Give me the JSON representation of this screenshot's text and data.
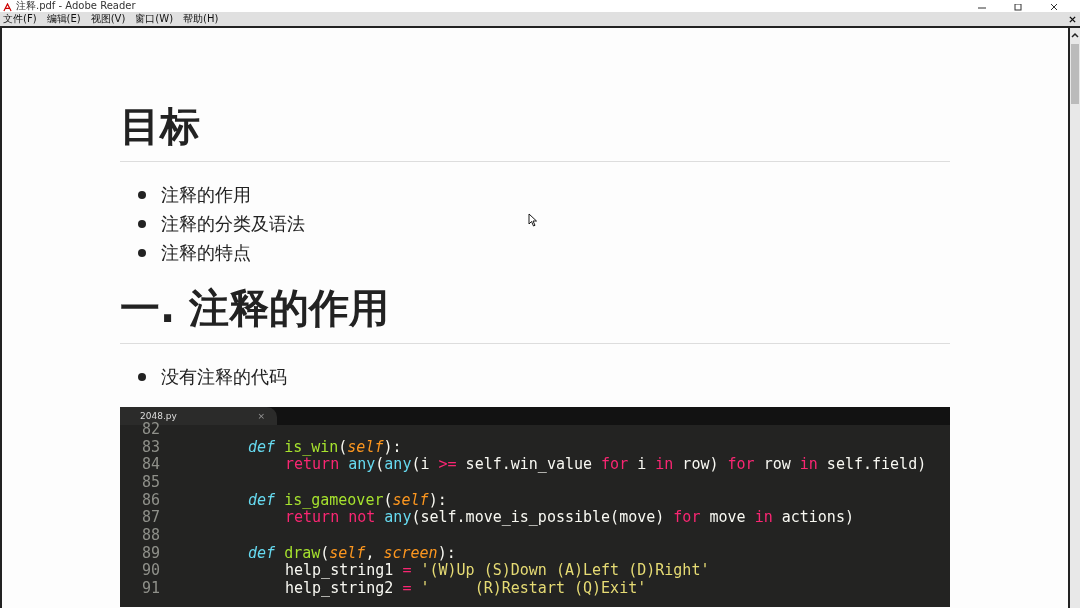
{
  "window": {
    "title": "注释.pdf - Adobe Reader"
  },
  "menu": [
    "文件(F)",
    "编辑(E)",
    "视图(V)",
    "窗口(W)",
    "帮助(H)"
  ],
  "document": [
    {
      "kind": "heading",
      "text": "目标"
    },
    {
      "kind": "bullets",
      "items": [
        "注释的作用",
        "注释的分类及语法",
        "注释的特点"
      ]
    },
    {
      "kind": "heading",
      "text": "一. 注释的作用"
    },
    {
      "kind": "bullets",
      "items": [
        "没有注释的代码"
      ]
    },
    {
      "kind": "code",
      "tab": "2048.py",
      "tab_close": "×",
      "lines": [
        {
          "number": "82"
        },
        {
          "number": "83",
          "kind": "method",
          "tokens": [
            {
              "text": "def ",
              "kind": "def"
            },
            {
              "text": "is_win",
              "kind": "fn"
            },
            {
              "text": "(",
              "kind": "plain"
            },
            {
              "text": "self",
              "kind": "self"
            },
            {
              "text": "):",
              "kind": "plain"
            }
          ]
        },
        {
          "number": "84",
          "kind": "body",
          "tokens": [
            {
              "text": "return ",
              "kind": "kw"
            },
            {
              "text": "any",
              "kind": "builtin"
            },
            {
              "text": "(",
              "kind": "plain"
            },
            {
              "text": "any",
              "kind": "builtin"
            },
            {
              "text": "(i ",
              "kind": "plain"
            },
            {
              "text": ">=",
              "kind": "kw"
            },
            {
              "text": " self.win_value ",
              "kind": "plain"
            },
            {
              "text": "for",
              "kind": "kw"
            },
            {
              "text": " i ",
              "kind": "plain"
            },
            {
              "text": "in",
              "kind": "kw"
            },
            {
              "text": " row) ",
              "kind": "plain"
            },
            {
              "text": "for",
              "kind": "kw"
            },
            {
              "text": " row ",
              "kind": "plain"
            },
            {
              "text": "in",
              "kind": "kw"
            },
            {
              "text": " self.field)",
              "kind": "plain"
            }
          ]
        },
        {
          "number": "85"
        },
        {
          "number": "86",
          "kind": "method",
          "tokens": [
            {
              "text": "def ",
              "kind": "def"
            },
            {
              "text": "is_gameover",
              "kind": "fn"
            },
            {
              "text": "(",
              "kind": "plain"
            },
            {
              "text": "self",
              "kind": "self"
            },
            {
              "text": "):",
              "kind": "plain"
            }
          ]
        },
        {
          "number": "87",
          "kind": "body",
          "tokens": [
            {
              "text": "return ",
              "kind": "kw"
            },
            {
              "text": "not ",
              "kind": "kw"
            },
            {
              "text": "any",
              "kind": "builtin"
            },
            {
              "text": "(self.move_is_possible(move) ",
              "kind": "plain"
            },
            {
              "text": "for",
              "kind": "kw"
            },
            {
              "text": " move ",
              "kind": "plain"
            },
            {
              "text": "in",
              "kind": "kw"
            },
            {
              "text": " actions)",
              "kind": "plain"
            }
          ]
        },
        {
          "number": "88"
        },
        {
          "number": "89",
          "kind": "method",
          "tokens": [
            {
              "text": "def ",
              "kind": "def"
            },
            {
              "text": "draw",
              "kind": "fn"
            },
            {
              "text": "(",
              "kind": "plain"
            },
            {
              "text": "self",
              "kind": "self"
            },
            {
              "text": ", ",
              "kind": "plain"
            },
            {
              "text": "screen",
              "kind": "self"
            },
            {
              "text": "):",
              "kind": "plain"
            }
          ]
        },
        {
          "number": "90",
          "kind": "body",
          "tokens": [
            {
              "text": "help_string1 ",
              "kind": "plain"
            },
            {
              "text": "= ",
              "kind": "kw"
            },
            {
              "text": "'(W)Up (S)Down (A)Left (D)Right'",
              "kind": "str"
            }
          ]
        },
        {
          "number": "91",
          "kind": "body",
          "tokens": [
            {
              "text": "help_string2 ",
              "kind": "plain"
            },
            {
              "text": "= ",
              "kind": "kw"
            },
            {
              "text": "'     (R)Restart (Q)Exit'",
              "kind": "str"
            }
          ]
        }
      ]
    }
  ]
}
